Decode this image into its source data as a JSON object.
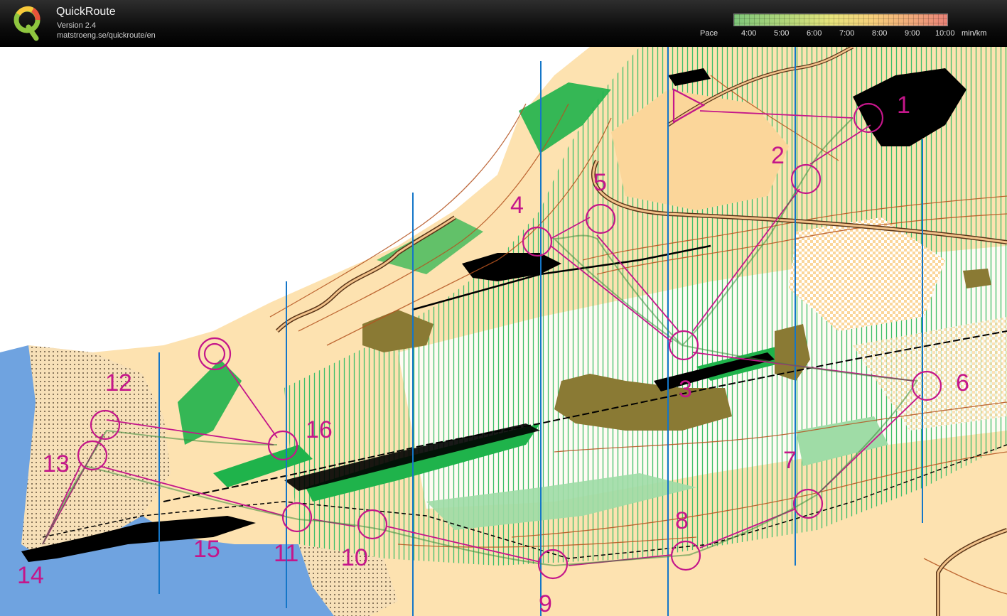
{
  "app": {
    "title": "QuickRoute",
    "version": "Version 2.4",
    "url": "matstroeng.se/quickroute/en",
    "logo_letter": "Q"
  },
  "pace": {
    "label": "Pace",
    "ticks": [
      "4:00",
      "5:00",
      "6:00",
      "7:00",
      "8:00",
      "9:00",
      "10:00"
    ],
    "unit": "min/km",
    "colors": [
      "#7fc67a",
      "#e6e47c",
      "#e98277"
    ]
  },
  "map": {
    "controls": [
      "1",
      "2",
      "3",
      "4",
      "5",
      "6",
      "7",
      "8",
      "9",
      "10",
      "11",
      "12",
      "13",
      "14",
      "15",
      "16"
    ],
    "course_color": "#c4168a",
    "water_color": "#6fa3e0",
    "forest_green": "#1fb34b",
    "open_land": "#fbd69a"
  }
}
